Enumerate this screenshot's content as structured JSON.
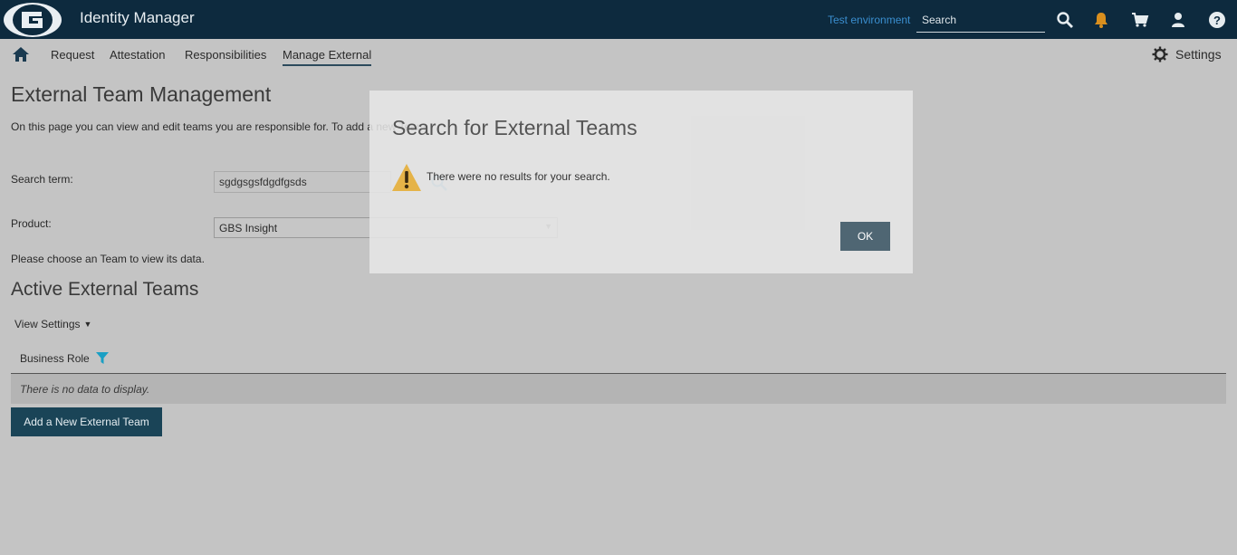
{
  "header": {
    "app_title": "Identity Manager",
    "environment_link": "Test environment",
    "search_placeholder": "Search",
    "icons": [
      "search-icon",
      "bell-icon",
      "cart-icon",
      "user-icon",
      "help-icon"
    ],
    "bell_color": "#d98f1e"
  },
  "nav": {
    "items": [
      {
        "label": "Request"
      },
      {
        "label": "Attestation"
      },
      {
        "label": "Responsibilities"
      },
      {
        "label": "Manage External",
        "active": true
      }
    ],
    "settings_label": "Settings"
  },
  "page": {
    "title": "External Team Management",
    "description": "On this page you can view and edit teams you are responsible for. To add a new Team",
    "search_term_label": "Search term:",
    "search_term_value": "sgdgsgsfdgdfgsds",
    "product_label": "Product:",
    "product_value": "GBS Insight",
    "choose_text": "Please choose an Team to view its data.",
    "section_title": "Active External Teams",
    "view_settings_label": "View Settings",
    "table": {
      "columns": [
        "Business Role"
      ],
      "empty_message": "There is no data to display."
    },
    "add_button_label": "Add a New External Team"
  },
  "modal": {
    "title": "Search for External Teams",
    "message": "There were no results for your search.",
    "ok_label": "OK"
  },
  "colors": {
    "topbar": "#0d2a3e",
    "primary_button": "#1a4457",
    "ok_button": "#4f6673",
    "filter_icon": "#1a9fc4"
  }
}
